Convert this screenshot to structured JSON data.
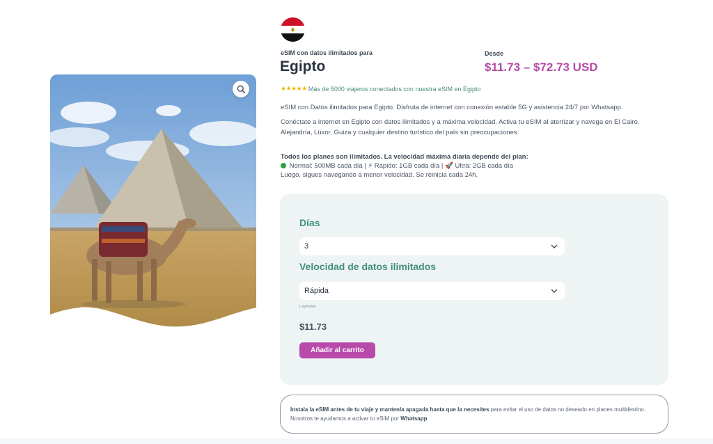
{
  "product": {
    "subtitle": "eSIM con datos ilimitados para",
    "title": "Egipto",
    "price_label": "Desde",
    "price_range": "$11.73 – $72.73 USD",
    "image_icon": "egypt-pyramids-camel-photo",
    "zoom_icon": "magnifier-icon",
    "flag_icon": "egypt-flag-icon"
  },
  "rating": {
    "stars": "★★★★★",
    "text": "Más de 5000 viajeros conectados con nuestra eSIM en Egipto"
  },
  "description": {
    "line1": "eSIM con Datos ilimitados para Egipto. Disfruta de internet con conexión estable 5G y asistencia 24/7 por Whatsapp.",
    "line2": "Conéctate a internet en Egipto con datos ilimitados y a máxima velocidad. Activa tu eSIM al aterrizar y navega en El Cairo, Alejandría, Lúxor, Guiza y cualquier destino turístico del país sin preocupaciones."
  },
  "plans": {
    "heading": "Todos los planes son ilimitados. La velocidad máxima diaria depende del plan:",
    "tiers": " Normal: 500MB cada día | ⚡ Rápido: 1GB cada día | 🚀 Ultra: 2GB cada día",
    "footer": "Luego, sigues navegando a menor velocidad. Se reinicia cada 24h."
  },
  "options": {
    "days_label": "Días",
    "days_value": "3",
    "speed_label": "Velocidad de datos ilimitados",
    "speed_value": "Rápida",
    "clear_label": "LIMPIAR",
    "selected_price": "$11.73",
    "add_to_cart": "Añadir al carrito"
  },
  "notice": {
    "bold_start": "Instala la eSIM antes de tu viaje y mantenla apagada hasta que la necesites",
    "text": " para evitar el uso de datos no deseado en planes multidestino. Nosotros te ayudamos a activar tu eSIM por ",
    "bold_end": "Whatsapp"
  },
  "colors": {
    "accent_purple": "#b84aac",
    "accent_green": "#3f8f7c",
    "card_bg": "#eef4f3"
  }
}
